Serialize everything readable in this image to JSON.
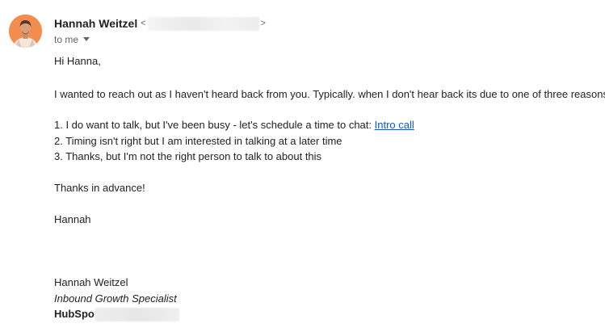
{
  "sender": {
    "name": "Hannah Weitzel",
    "angle_open": "<",
    "angle_close": ">"
  },
  "recipient": {
    "label": "to me"
  },
  "icons": {
    "avatar": "person-avatar-photo",
    "recipient_details": "chevron-down-icon"
  },
  "body": {
    "greeting": "Hi Hanna,",
    "intro": "I wanted to reach out as I haven't heard back from you. Typically. when I don't hear back its due to one of three reasons:",
    "option1_text": "1. I do want to talk, but I've been busy - let's schedule a time to chat: ",
    "option1_link": "Intro call",
    "option2": "2. Timing isn't right but I am interested in talking at a later time",
    "option3": "3. Thanks, but I'm not the right person to talk to about this",
    "thanks": "Thanks in advance!",
    "signoff": "Hannah"
  },
  "signature": {
    "name": "Hannah Weitzel",
    "title": "Inbound Growth Specialist",
    "company_partial": "HubSpo"
  },
  "colors": {
    "link": "#1155cc",
    "text": "#222222",
    "meta": "#5f6368",
    "avatar_bg": "#f28c4f"
  }
}
